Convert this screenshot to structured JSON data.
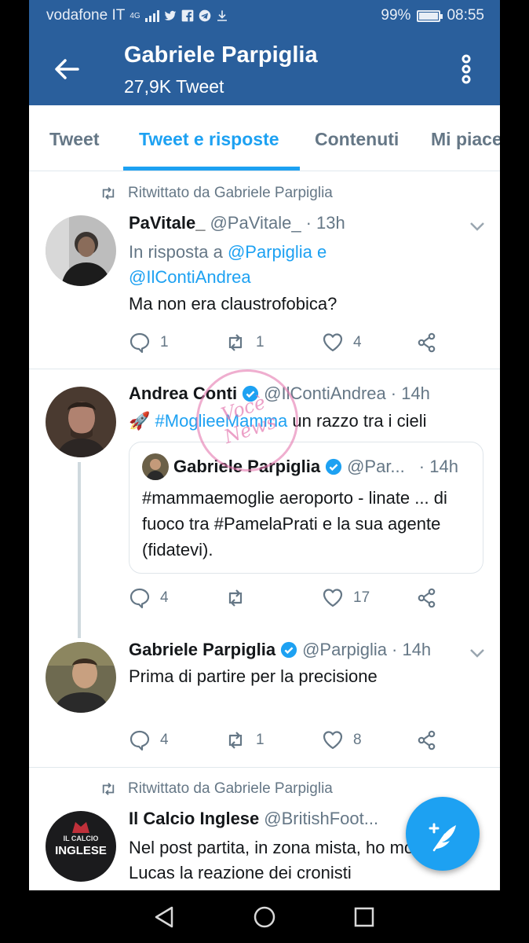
{
  "status_bar": {
    "carrier": "vodafone IT",
    "network": "4G",
    "battery": "99%",
    "battery_level": 0.99,
    "time": "08:55"
  },
  "app_bar": {
    "title": "Gabriele Parpiglia",
    "subtitle": "27,9K Tweet"
  },
  "tabs": [
    {
      "label": "Tweet",
      "active": false
    },
    {
      "label": "Tweet e risposte",
      "active": true
    },
    {
      "label": "Contenuti",
      "active": false
    },
    {
      "label": "Mi piace",
      "active": false
    }
  ],
  "tweets": [
    {
      "retweeted_by": "Ritwittato da Gabriele Parpiglia",
      "name": "PaVitale_",
      "handle": "@PaVitale_",
      "time": "· 13h",
      "reply_prefix": "In risposta a",
      "reply_to_1": "@Parpiglia",
      "reply_and": "e",
      "reply_to_2": "@IlContiAndrea",
      "text": "Ma non era claustrofobica?",
      "replies": "1",
      "retweets": "1",
      "likes": "4"
    },
    {
      "name": "Andrea Conti",
      "handle": "@IlContiAndrea",
      "time": "· 14h",
      "emoji": "🚀",
      "hashtag": "#MoglieeMamma",
      "text": "un razzo tra i cieli",
      "quote": {
        "name": "Gabriele Parpiglia",
        "handle": "@Par...",
        "time": "· 14h",
        "text": "#mammaemoglie aeroporto - linate ... di fuoco tra #PamelaPrati e la sua agente (fidatevi)."
      },
      "replies": "4",
      "retweets": "",
      "likes": "17"
    },
    {
      "name": "Gabriele Parpiglia",
      "handle": "@Parpiglia",
      "time": "· 14h",
      "text": "Prima di partire per la precisione",
      "replies": "4",
      "retweets": "1",
      "likes": "8"
    },
    {
      "retweeted_by": "Ritwittato da Gabriele Parpiglia",
      "name": "Il Calcio Inglese",
      "handle": "@BritishFoot...",
      "avatar_text_1": "IL CALCIO",
      "avatar_text_2": "INGLESE",
      "text": "Nel post partita, in zona mista, ho mostrato a Lucas la reazione dei cronisti"
    }
  ],
  "watermark": "Vocè News",
  "colors": {
    "app_bar": "#2a5f9c",
    "accent": "#1da1f2",
    "secondary_text": "#657786"
  }
}
